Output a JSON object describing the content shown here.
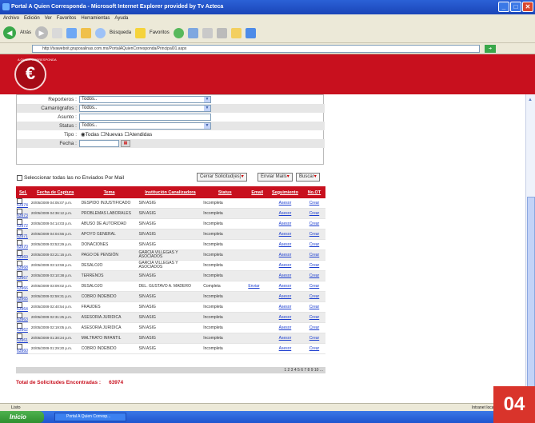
{
  "window": {
    "title": "Portal A Quien Corresponda - Microsoft Internet Explorer provided by Tv Azteca"
  },
  "menu": [
    "Archivo",
    "Edición",
    "Ver",
    "Favoritos",
    "Herramientas",
    "Ayuda"
  ],
  "toolbar": {
    "back": "Atrás",
    "search": "Búsqueda",
    "favorites": "Favoritos"
  },
  "address": {
    "url": "http://tvaweboit.gruposalinas.com.mx/PortalAQuienCorresponda/Principal01.aspx"
  },
  "logo": {
    "text": "A QUIEN CORRESPONDA"
  },
  "form": {
    "reporteros_label": "Reporteros :",
    "reporteros_value": "Todos..",
    "camarografos_label": "Camarógrafos :",
    "camarografos_value": "Todos..",
    "asunto_label": "Asunto :",
    "status_label": "Status :",
    "status_value": "Todos..",
    "tipo_label": "Tipo :",
    "tipo_options": "◉Todas ☐Nuevas ☐Atendidas",
    "fecha_label": "Fecha :"
  },
  "actions": {
    "select_all": "Seleccionar todas las no Enviados Por Mail",
    "cerrar": "Cerrar Solicitud(es)",
    "enviar": "Enviar Mails",
    "buscar": "Buscar"
  },
  "table": {
    "headers": [
      "Sel.",
      "Fecha de Captura",
      "Tema",
      "Institución Canalizadora",
      "Status",
      "Email",
      "Seguimiento",
      "No.OT"
    ],
    "rows": [
      {
        "id": "63974",
        "fecha": "20/05/2009 04:05:07 p.m.",
        "tema": "DESPIDO INJUSTIFICADO",
        "inst": "SIN ASIG",
        "status": "Incompleta",
        "email": "",
        "seg": "Asesor",
        "ot": "Crear"
      },
      {
        "id": "63973",
        "fecha": "20/05/2009 04:36:12 p.m.",
        "tema": "PROBLEMAS LABORALES",
        "inst": "SIN ASIG",
        "status": "Incompleta",
        "email": "",
        "seg": "Asesor",
        "ot": "Crear"
      },
      {
        "id": "63972",
        "fecha": "20/05/2009 04:14:03 p.m.",
        "tema": "ABUSO DE AUTORIDAD",
        "inst": "SIN ASIG",
        "status": "Incompleta",
        "email": "",
        "seg": "Asesor",
        "ot": "Crear"
      },
      {
        "id": "63971",
        "fecha": "20/05/2009 04:04:56 p.m.",
        "tema": "APOYO GENERAL",
        "inst": "SIN ASIG",
        "status": "Incompleta",
        "email": "",
        "seg": "Asesor",
        "ot": "Crear"
      },
      {
        "id": "63970",
        "fecha": "20/05/2009 03:53:29 p.m.",
        "tema": "DONACIONES",
        "inst": "SIN ASIG",
        "status": "Incompleta",
        "email": "",
        "seg": "Asesor",
        "ot": "Crear"
      },
      {
        "id": "63969",
        "fecha": "20/05/2009 03:21:16 p.m.",
        "tema": "PAGO DE PENSIÓN",
        "inst": "GARCIA VILLEGAS Y ASOCIADOS",
        "status": "Incompleta",
        "email": "",
        "seg": "Asesor",
        "ot": "Crear"
      },
      {
        "id": "63968",
        "fecha": "20/05/2009 03:13:59 p.m.",
        "tema": "DESALOJO",
        "inst": "GARCIA VILLEGAS Y ASOCIADOS",
        "status": "Incompleta",
        "email": "",
        "seg": "Asesor",
        "ot": "Crear"
      },
      {
        "id": "63967",
        "fecha": "20/05/2009 03:10:38 p.m.",
        "tema": "TERRENOS",
        "inst": "SIN ASIG",
        "status": "Incompleta",
        "email": "",
        "seg": "Asesor",
        "ot": "Crear"
      },
      {
        "id": "63966",
        "fecha": "20/05/2009 03:09:02 p.m.",
        "tema": "DESALOJO",
        "inst": "DEL. GUSTAVO A. MADERO",
        "status": "Completa",
        "email": "Enviar",
        "seg": "Asesor",
        "ot": "Crear"
      },
      {
        "id": "63965",
        "fecha": "20/05/2009 02:59:31 p.m.",
        "tema": "COBRO INDEBIDO",
        "inst": "SIN ASIG",
        "status": "Incompleta",
        "email": "",
        "seg": "Asesor",
        "ot": "Crear"
      },
      {
        "id": "63964",
        "fecha": "20/05/2009 02:40:54 p.m.",
        "tema": "FRAUDES",
        "inst": "SIN ASIG",
        "status": "Incompleta",
        "email": "",
        "seg": "Asesor",
        "ot": "Crear"
      },
      {
        "id": "63963",
        "fecha": "20/05/2009 02:31:25 p.m.",
        "tema": "ASESORIA JURIDICA",
        "inst": "SIN ASIG",
        "status": "Incompleta",
        "email": "",
        "seg": "Asesor",
        "ot": "Crear"
      },
      {
        "id": "63962",
        "fecha": "20/05/2009 02:19:05 p.m.",
        "tema": "ASESORIA JURIDICA",
        "inst": "SIN ASIG",
        "status": "Incompleta",
        "email": "",
        "seg": "Asesor",
        "ot": "Crear"
      },
      {
        "id": "63961",
        "fecha": "20/05/2009 01:30:24 p.m.",
        "tema": "MALTRATO INFANTIL",
        "inst": "SIN ASIG",
        "status": "Incompleta",
        "email": "",
        "seg": "Asesor",
        "ot": "Crear"
      },
      {
        "id": "63960",
        "fecha": "20/05/2009 01:29:20 p.m.",
        "tema": "COBRO INDEBIDO",
        "inst": "SIN ASIG",
        "status": "Incompleta",
        "email": "",
        "seg": "Asesor",
        "ot": "Crear"
      }
    ]
  },
  "pager": "1 2 3 4 5 6 7 8 9 10 ...",
  "total": {
    "label": "Total de Solicitudes Encontradas :",
    "value": "63974"
  },
  "status": {
    "left": "Listo",
    "zone": "Intranet local"
  },
  "taskbar": {
    "start": "Inicio",
    "task": "Portal A Quien Corresp..."
  },
  "badge": "04"
}
